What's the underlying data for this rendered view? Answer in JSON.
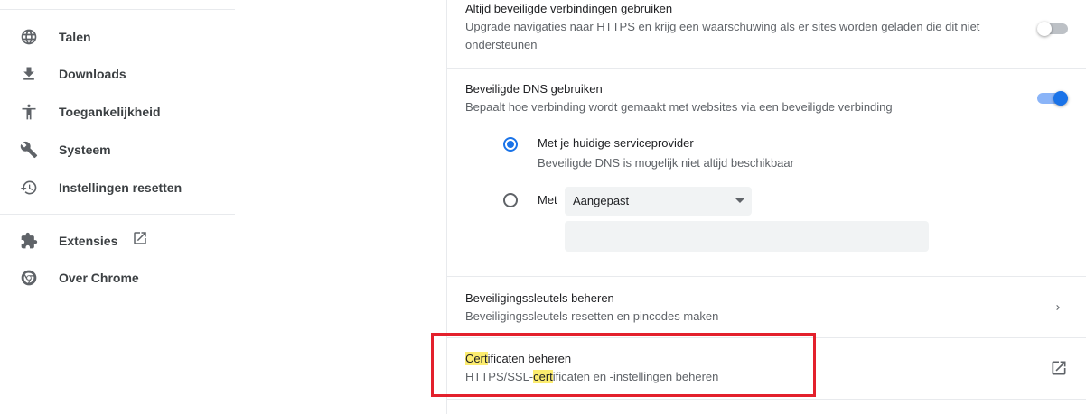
{
  "sidebar": {
    "items": [
      {
        "label": "Talen",
        "icon": "globe-icon"
      },
      {
        "label": "Downloads",
        "icon": "download-icon"
      },
      {
        "label": "Toegankelijkheid",
        "icon": "accessibility-icon"
      },
      {
        "label": "Systeem",
        "icon": "wrench-icon"
      },
      {
        "label": "Instellingen resetten",
        "icon": "restore-icon"
      },
      {
        "label": "Extensies",
        "icon": "puzzle-icon"
      },
      {
        "label": "Over Chrome",
        "icon": "chrome-icon"
      }
    ]
  },
  "main": {
    "https_only": {
      "title": "Altijd beveiligde verbindingen gebruiken",
      "subtitle": "Upgrade navigaties naar HTTPS en krijg een waarschuwing als er sites worden geladen die dit niet ondersteunen",
      "enabled": false
    },
    "secure_dns": {
      "title": "Beveiligde DNS gebruiken",
      "subtitle": "Bepaalt hoe verbinding wordt gemaakt met websites via een beveiligde verbinding",
      "enabled": true,
      "option_current": {
        "label": "Met je huidige serviceprovider",
        "sublabel": "Beveiligde DNS is mogelijk niet altijd beschikbaar",
        "checked": true
      },
      "option_custom": {
        "label": "Met",
        "checked": false,
        "provider_value": "Aangepast",
        "custom_input_value": "",
        "custom_input_placeholder": ""
      }
    },
    "security_keys": {
      "title": "Beveiligingssleutels beheren",
      "subtitle": "Beveiligingssleutels resetten en pincodes maken"
    },
    "certificates": {
      "title_highlight": "Cert",
      "title_rest": "ificaten beheren",
      "subtitle_prefix": "HTTPS/SSL-",
      "subtitle_highlight": "cert",
      "subtitle_rest": "ificaten en -instellingen beheren"
    }
  },
  "colors": {
    "accent": "#1a73e8",
    "search_highlight": "#fcec6f",
    "annotation_box": "#e3202c"
  }
}
